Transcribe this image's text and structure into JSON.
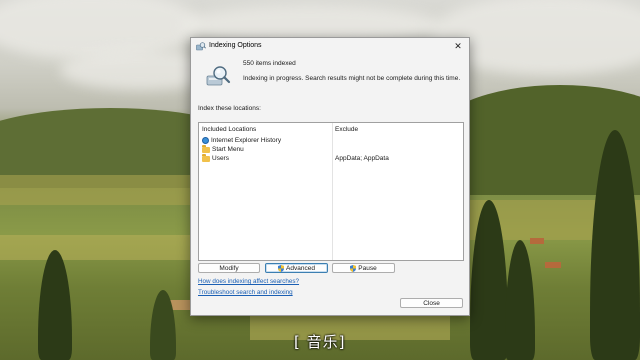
{
  "window": {
    "title": "Indexing Options",
    "close_glyph": "✕"
  },
  "status": {
    "count_text": "550 items indexed",
    "progress_text": "Indexing in progress. Search results might not be complete during this time."
  },
  "locations": {
    "label": "Index these locations:",
    "columns": {
      "included": "Included Locations",
      "exclude": "Exclude"
    },
    "rows": [
      {
        "name": "Internet Explorer History",
        "icon": "internet-explorer-icon",
        "exclude": ""
      },
      {
        "name": "Start Menu",
        "icon": "folder-icon",
        "exclude": ""
      },
      {
        "name": "Users",
        "icon": "folder-icon",
        "exclude": "AppData; AppData"
      }
    ]
  },
  "buttons": {
    "modify": "Modify",
    "advanced": "Advanced",
    "pause": "Pause",
    "close": "Close"
  },
  "links": {
    "how_affect": "How does indexing affect searches?",
    "troubleshoot": "Troubleshoot search and indexing"
  },
  "caption": "[ 音乐]",
  "colors": {
    "link": "#1a5fb4",
    "dialog_bg": "#f3f3f3",
    "primary_border": "#3c7fb1"
  }
}
